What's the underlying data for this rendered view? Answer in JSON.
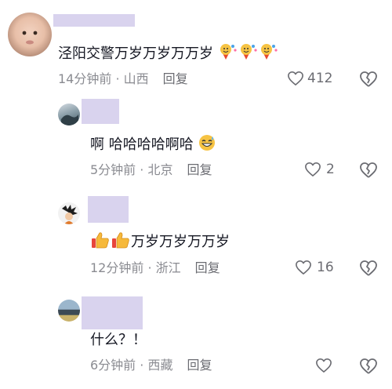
{
  "comments": [
    {
      "text": "泾阳交警万岁万岁万万岁",
      "time": "14分钟前",
      "location": "山西",
      "reply_label": "回复",
      "likes": "412",
      "emoji": "party-face-with-bouquet x3"
    },
    {
      "text": "啊 哈哈哈哈啊哈",
      "time": "5分钟前",
      "location": "北京",
      "reply_label": "回复",
      "likes": "2",
      "emoji": "grinning-sweat-face"
    },
    {
      "text": "万岁万岁万万岁",
      "time": "12分钟前",
      "location": "浙江",
      "reply_label": "回复",
      "likes": "16",
      "emoji": "thumbs-up x2"
    },
    {
      "text": "什么？！",
      "time": "6分钟前",
      "location": "西藏",
      "reply_label": "回复",
      "likes": ""
    }
  ],
  "separator": " · "
}
